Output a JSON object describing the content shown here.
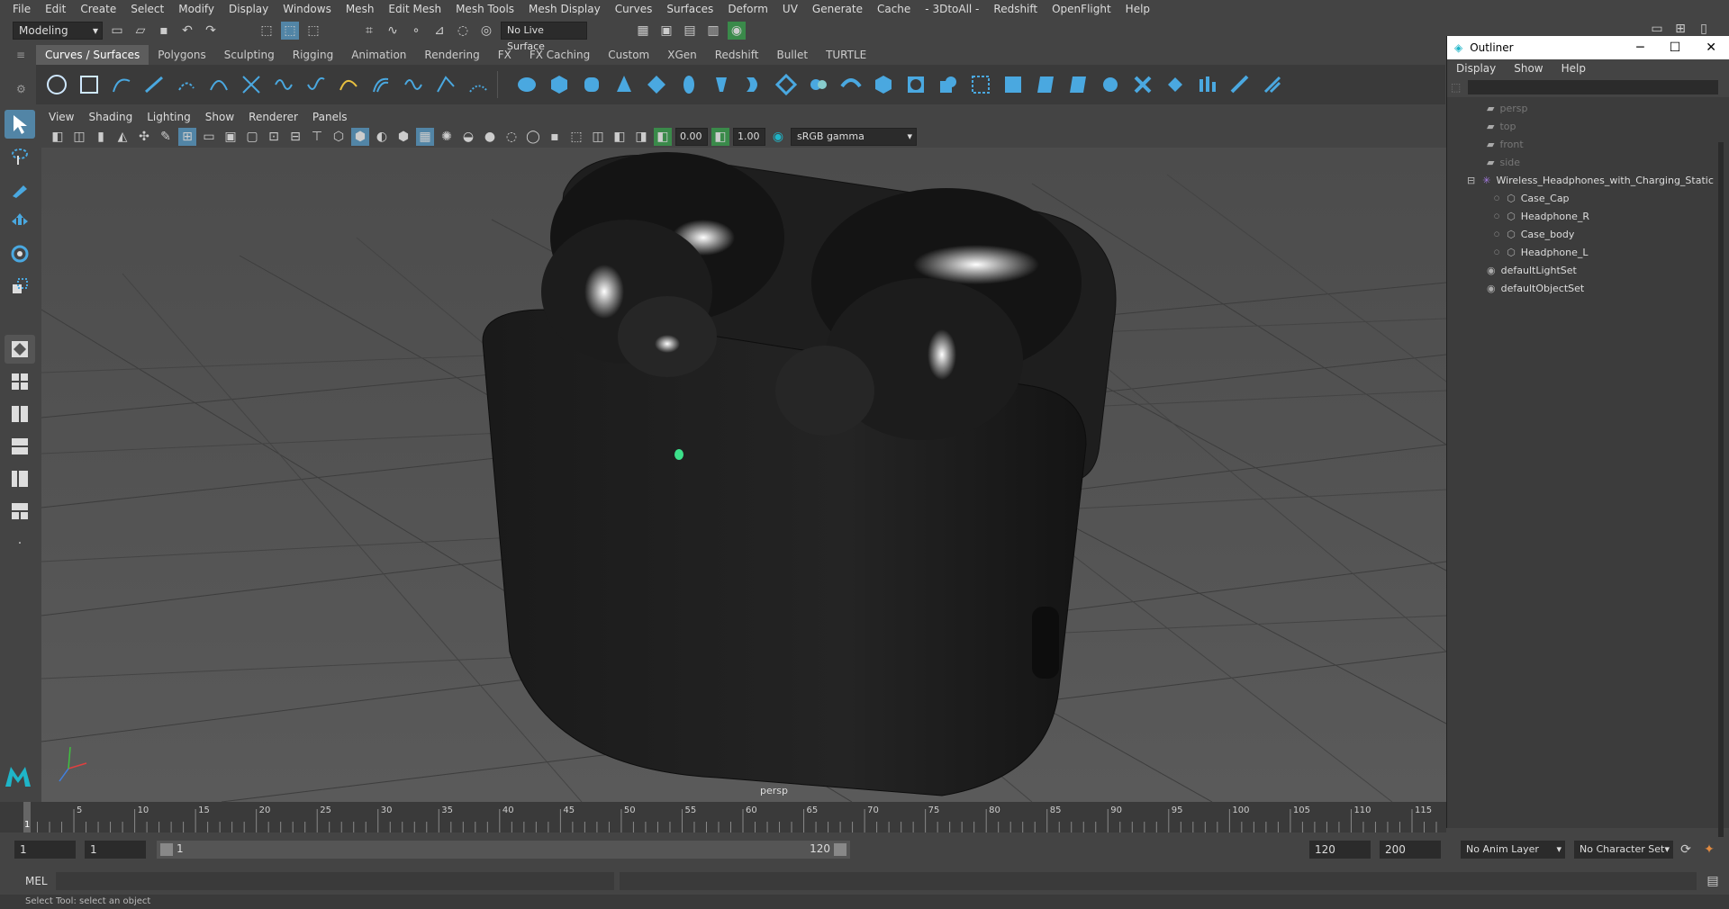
{
  "menu": [
    "File",
    "Edit",
    "Create",
    "Select",
    "Modify",
    "Display",
    "Windows",
    "Mesh",
    "Edit Mesh",
    "Mesh Tools",
    "Mesh Display",
    "Curves",
    "Surfaces",
    "Deform",
    "UV",
    "Generate",
    "Cache",
    "- 3DtoAll -",
    "Redshift",
    "OpenFlight",
    "Help"
  ],
  "status": {
    "mode": "Modeling",
    "live_surface": "No Live Surface"
  },
  "shelf_tabs": [
    "Curves / Surfaces",
    "Polygons",
    "Sculpting",
    "Rigging",
    "Animation",
    "Rendering",
    "FX",
    "FX Caching",
    "Custom",
    "XGen",
    "Redshift",
    "Bullet",
    "TURTLE"
  ],
  "viewport": {
    "menu": [
      "View",
      "Shading",
      "Lighting",
      "Show",
      "Renderer",
      "Panels"
    ],
    "exposure": "0.00",
    "gamma": "1.00",
    "color_space": "sRGB gamma",
    "camera_label": "persp"
  },
  "outliner": {
    "title": "Outliner",
    "menu": [
      "Display",
      "Show",
      "Help"
    ],
    "items": [
      {
        "label": "persp",
        "type": "camera",
        "depth": 0,
        "dim": true
      },
      {
        "label": "top",
        "type": "camera",
        "depth": 0,
        "dim": true
      },
      {
        "label": "front",
        "type": "camera",
        "depth": 0,
        "dim": true
      },
      {
        "label": "side",
        "type": "camera",
        "depth": 0,
        "dim": true
      },
      {
        "label": "Wireless_Headphones_with_Charging_Static",
        "type": "group",
        "depth": 0,
        "dim": false
      },
      {
        "label": "Case_Cap",
        "type": "mesh",
        "depth": 1,
        "dim": false
      },
      {
        "label": "Headphone_R",
        "type": "mesh",
        "depth": 1,
        "dim": false
      },
      {
        "label": "Case_body",
        "type": "mesh",
        "depth": 1,
        "dim": false
      },
      {
        "label": "Headphone_L",
        "type": "mesh",
        "depth": 1,
        "dim": false
      },
      {
        "label": "defaultLightSet",
        "type": "set",
        "depth": 0,
        "dim": false
      },
      {
        "label": "defaultObjectSet",
        "type": "set",
        "depth": 0,
        "dim": false
      }
    ]
  },
  "timeline": {
    "ticks": [
      "5",
      "10",
      "15",
      "20",
      "25",
      "30",
      "35",
      "40",
      "45",
      "50",
      "55",
      "60",
      "65",
      "70",
      "75",
      "80",
      "85",
      "90",
      "95",
      "100",
      "105",
      "110",
      "115"
    ],
    "current": "1"
  },
  "range": {
    "start": "1",
    "playback_start": "1",
    "slider_start": "1",
    "slider_end": "120",
    "playback_end": "120",
    "end": "200",
    "anim_layer": "No Anim Layer",
    "char_set": "No Character Set"
  },
  "command": {
    "label": "MEL"
  },
  "help_line": "Select Tool: select an object"
}
